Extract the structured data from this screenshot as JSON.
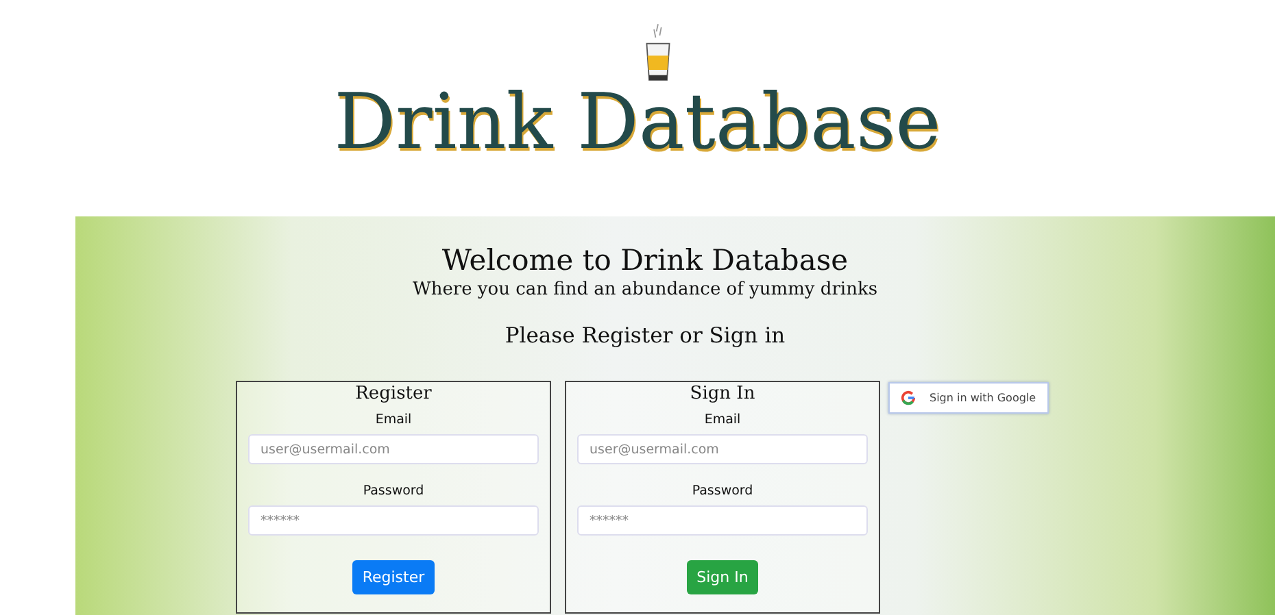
{
  "logo": {
    "title": "Drink Database"
  },
  "welcome": {
    "heading": "Welcome to Drink Database",
    "subheading": "Where you can find an abundance of yummy drinks",
    "prompt": "Please Register or Sign in"
  },
  "forms": [
    {
      "title": "Register",
      "fields": [
        {
          "label": "Email",
          "placeholder": "user@usermail.com"
        },
        {
          "label": "Password",
          "placeholder": "******"
        }
      ],
      "button": "Register",
      "kind": "primary"
    },
    {
      "title": "Sign In",
      "fields": [
        {
          "label": "Email",
          "placeholder": "user@usermail.com"
        },
        {
          "label": "Password",
          "placeholder": "******"
        }
      ],
      "button": "Sign In",
      "kind": "success"
    }
  ],
  "google_button": {
    "label": "Sign in with Google"
  }
}
